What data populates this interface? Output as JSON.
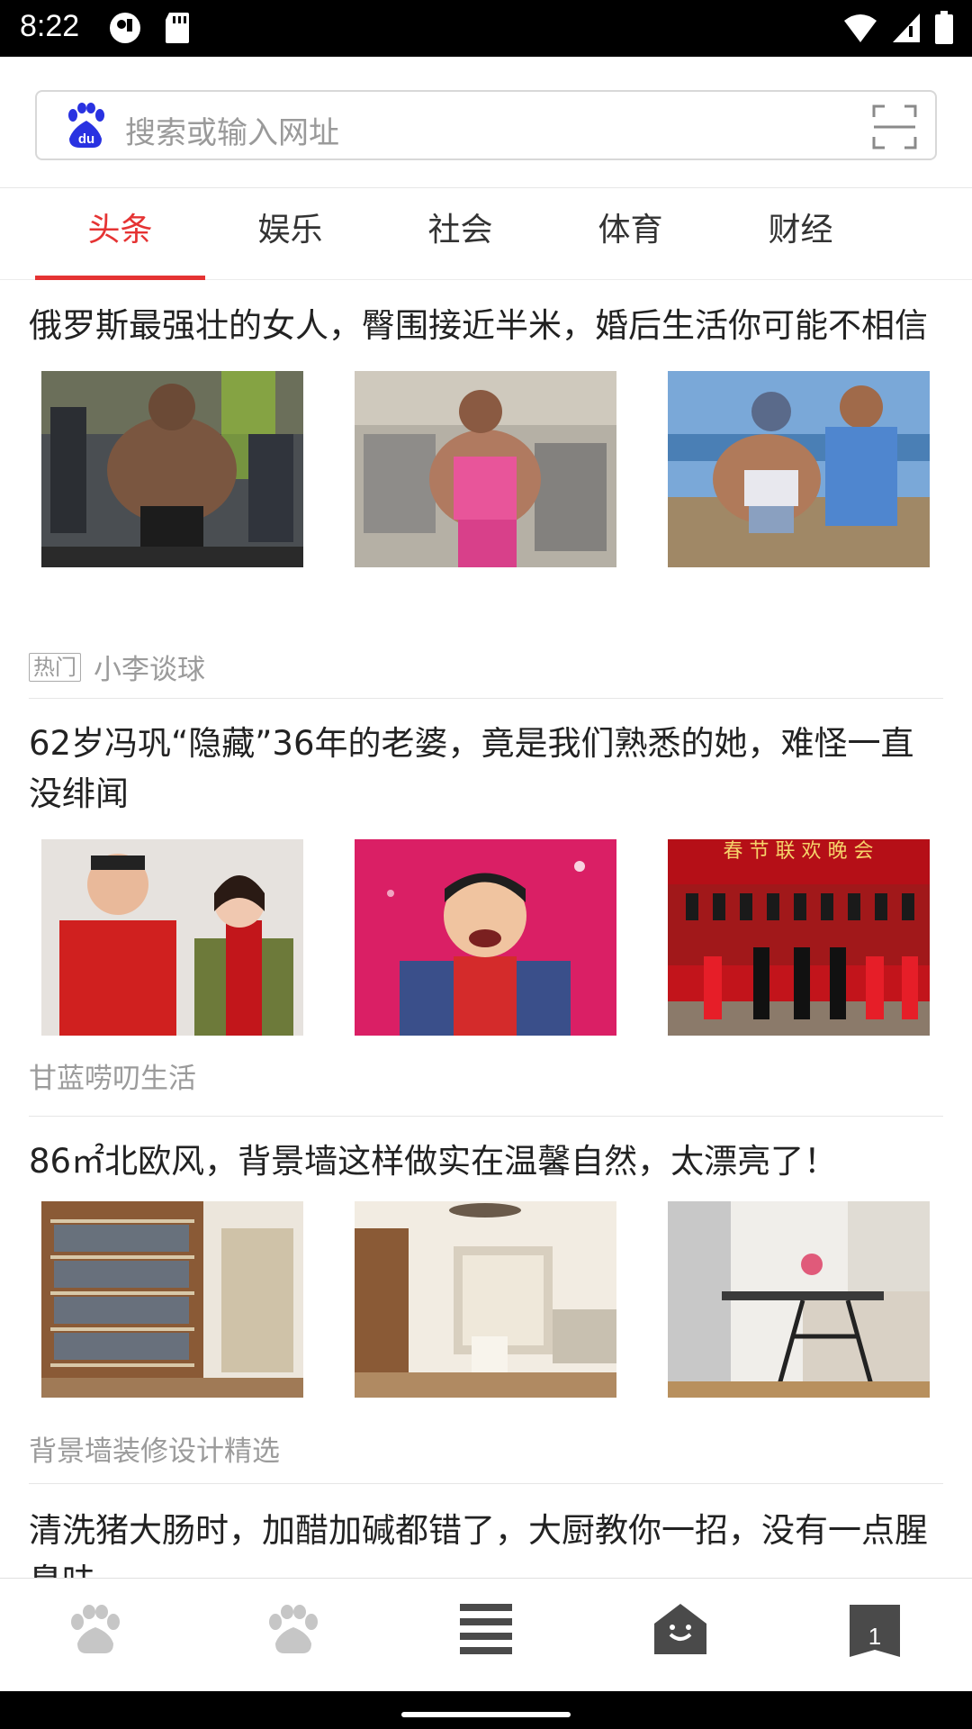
{
  "status_bar": {
    "time": "8:22"
  },
  "search": {
    "placeholder": "搜索或输入网址"
  },
  "tabs": [
    {
      "label": "头条",
      "active": true
    },
    {
      "label": "娱乐",
      "active": false
    },
    {
      "label": "社会",
      "active": false
    },
    {
      "label": "体育",
      "active": false
    },
    {
      "label": "财经",
      "active": false
    }
  ],
  "articles": [
    {
      "title": "俄罗斯最强壮的女人，臀围接近半米，婚后生活你可能不相信",
      "badge": "热门",
      "source": "小李谈球"
    },
    {
      "title": "62岁冯巩“隐藏”36年的老婆，竟是我们熟悉的她，难怪一直没绯闻",
      "badge": "",
      "source": "甘蓝唠叨生活"
    },
    {
      "title": "86㎡北欧风，背景墙这样做实在温馨自然，太漂亮了！",
      "badge": "",
      "source": "背景墙装修设计精选"
    },
    {
      "title": "清洗猪大肠时，加醋加碱都错了，大厨教你一招，没有一点腥臭味",
      "badge": "",
      "source": ""
    }
  ],
  "bottom_nav": {
    "tab_count": "1",
    "icons": [
      "paw-icon",
      "paw-icon",
      "menu-icon",
      "home-icon",
      "tabs-icon"
    ]
  },
  "colors": {
    "accent": "#e53333",
    "baidu_blue": "#2932e1"
  }
}
